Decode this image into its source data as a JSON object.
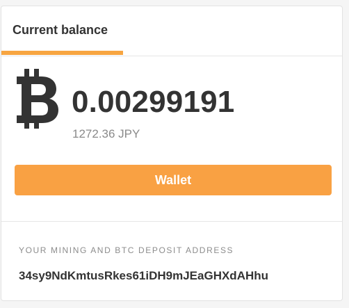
{
  "tab": {
    "label": "Current balance"
  },
  "balance": {
    "icon": "bitcoin-icon",
    "amount": "0.00299191",
    "fiat": "1272.36 JPY"
  },
  "wallet_button": {
    "label": "Wallet"
  },
  "deposit": {
    "label": "YOUR MINING AND BTC DEPOSIT ADDRESS",
    "address": "34sy9NdKmtusRkes61iDH9mJEaGHXdAHhu"
  },
  "colors": {
    "accent": "#f9a143",
    "text": "#333333",
    "muted": "#8a8a8a"
  }
}
